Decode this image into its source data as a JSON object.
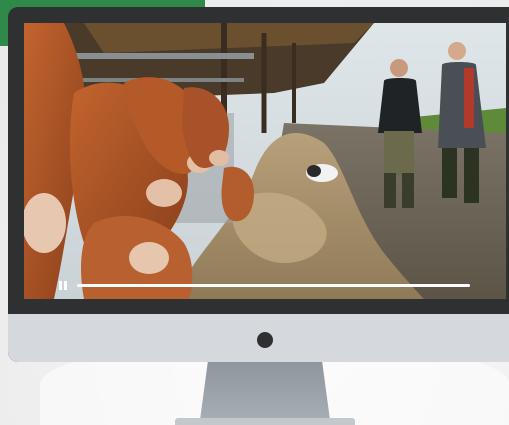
{
  "player": {
    "state": "playing",
    "control_icon": "pause-icon",
    "progress_fraction": 1.0
  },
  "colors": {
    "banner": "#2f8a4a",
    "bezel": "#2e3032",
    "chin": "#d5d8dc",
    "progress": "#ffffff"
  }
}
